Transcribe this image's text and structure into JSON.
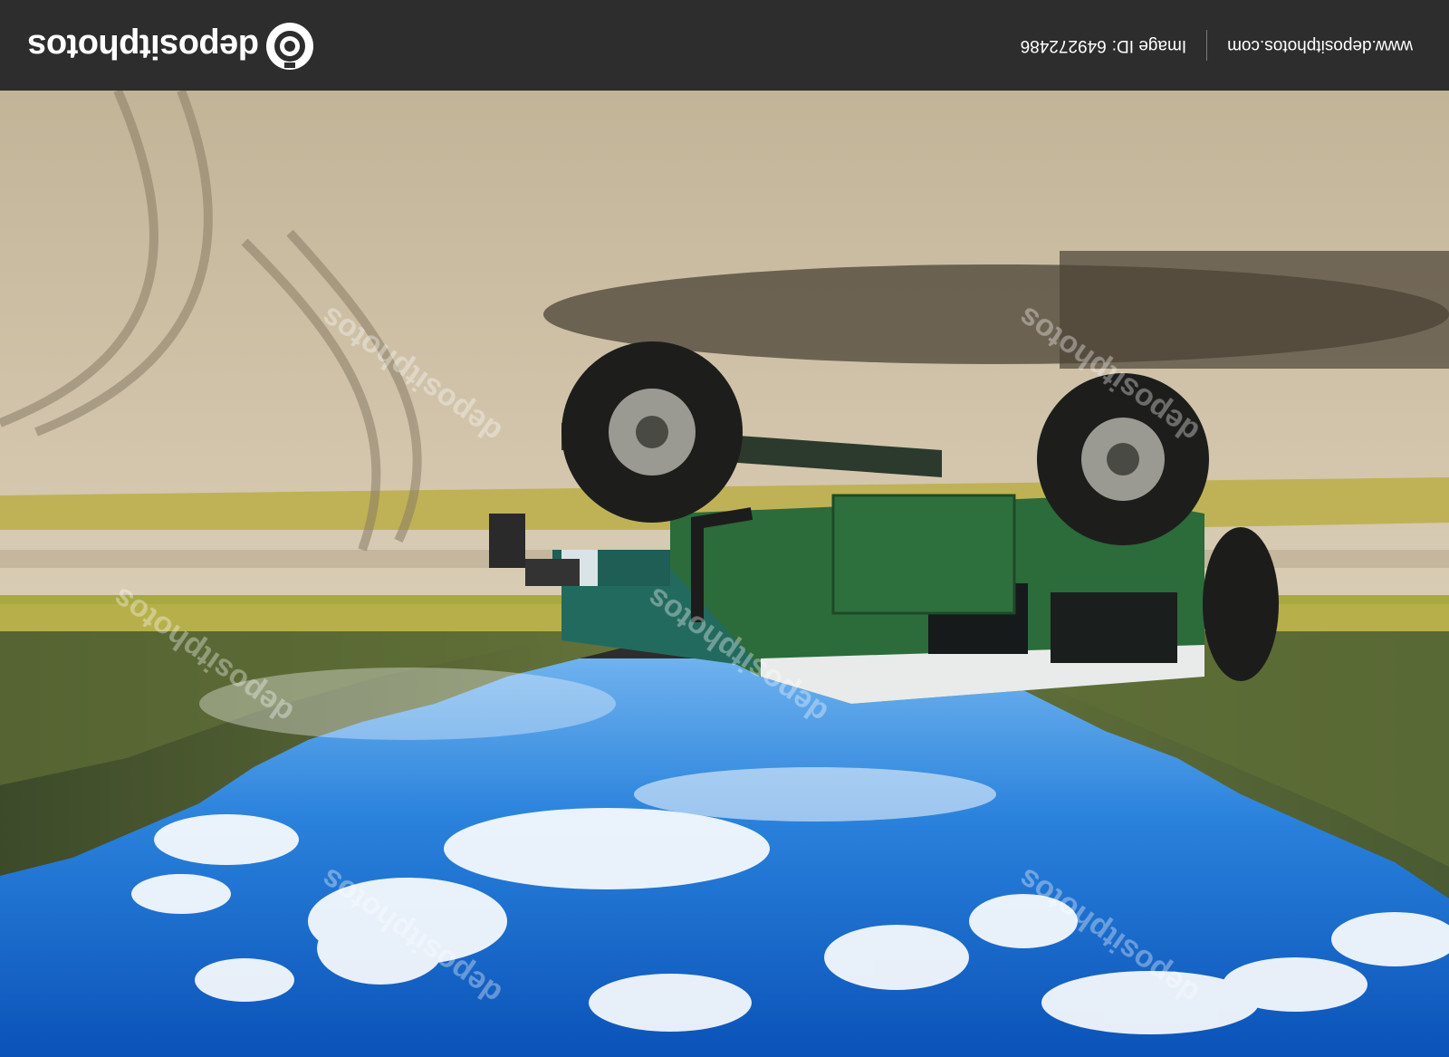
{
  "header": {
    "brand": "depositphotos",
    "image_id_label": "Image ID:",
    "image_id": "649272486",
    "site_url": "www.depositphotos.com"
  },
  "photo": {
    "subject": "green off-road jeep on volcanic sand plain with mountain ridge and blue sky",
    "orientation": "upside-down",
    "watermark_text": "depositphotos",
    "colors": {
      "header_bg": "#2d2d2d",
      "sky": "#1e6fd0",
      "sand": "#cdbfa6",
      "grass": "#b9b24a",
      "jeep": "#2c6b3a"
    }
  }
}
